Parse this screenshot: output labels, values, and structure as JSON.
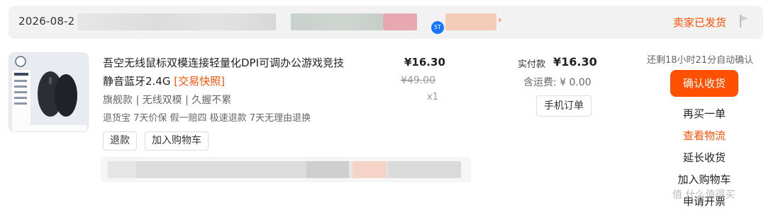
{
  "header": {
    "date": "2026-08-2",
    "status": "卖家已发货",
    "status_color": "#ff5000",
    "badge": "5T",
    "icons": [
      "flag-icon",
      "chevron-right-icon"
    ]
  },
  "product": {
    "title": "吾空无线鼠标双模连接轻量化DPI可调办公游戏竞技静音蓝牙2.4G",
    "snapshot": "[交易快照]",
    "specs": "旗舰款 | 无线双模 | 久握不累",
    "services": "退货宝 7天价保 假一赔四 极速退款 7天无理由退换",
    "buttons": {
      "refund": "退款",
      "add_cart": "加入购物车"
    },
    "price": "¥16.30",
    "original_price": "¥49.00",
    "quantity": "x1"
  },
  "payment": {
    "paid_label": "实付款",
    "paid_value": "¥16.30",
    "shipping": "含运费: ¥ 0.00",
    "mobile_order": "手机订单"
  },
  "actions": {
    "countdown": "还剩18小时21分自动确认",
    "confirm": "确认收货",
    "buy_again": "再买一单",
    "view_logistics": "查看物流",
    "extend": "延长收货",
    "add_cart": "加入购物车",
    "apply_invoice": "申请开票"
  },
  "watermark": "值 什么值得买",
  "colors": {
    "accent": "#ff5000",
    "header_bg": "#f2f2f2"
  }
}
